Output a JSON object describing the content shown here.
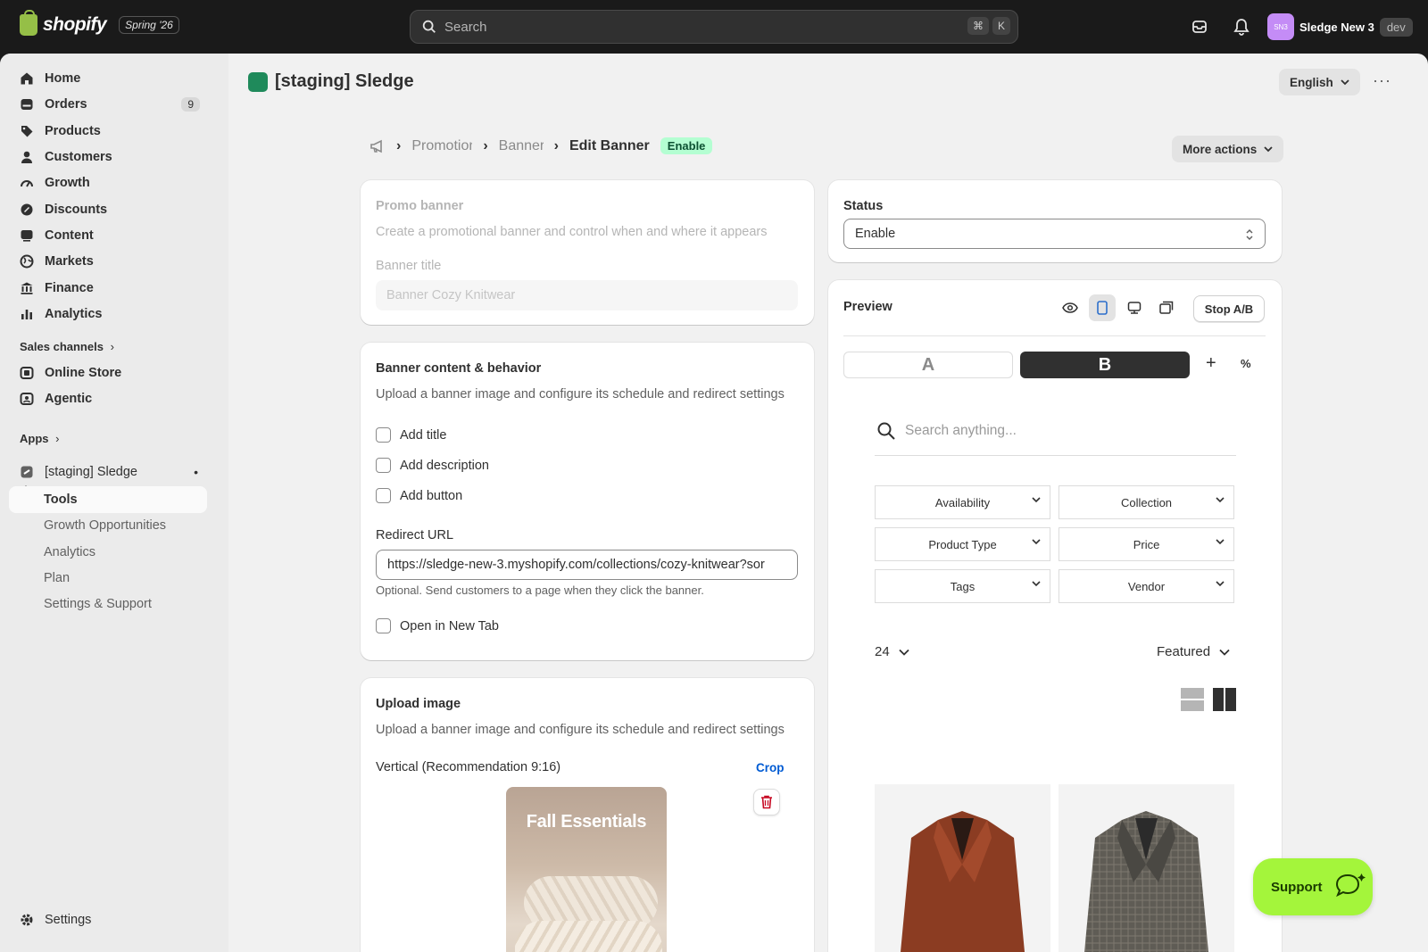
{
  "topbar": {
    "logo_text": "shopify",
    "edition_badge": "Spring '26",
    "search_placeholder": "Search",
    "shortcut_cmd": "⌘",
    "shortcut_key": "K",
    "store_initials": "SN3",
    "store_name": "Sledge New 3",
    "store_env": "dev"
  },
  "sidebar": {
    "items": [
      {
        "label": "Home",
        "icon": "home-icon"
      },
      {
        "label": "Orders",
        "icon": "orders-icon",
        "badge": "9"
      },
      {
        "label": "Products",
        "icon": "tag-icon"
      },
      {
        "label": "Customers",
        "icon": "person-icon"
      },
      {
        "label": "Growth",
        "icon": "growth-icon"
      },
      {
        "label": "Discounts",
        "icon": "discount-icon"
      },
      {
        "label": "Content",
        "icon": "content-icon"
      },
      {
        "label": "Markets",
        "icon": "globe-icon"
      },
      {
        "label": "Finance",
        "icon": "bank-icon"
      },
      {
        "label": "Analytics",
        "icon": "bar-chart-icon"
      }
    ],
    "sales_channels_label": "Sales channels",
    "channels": [
      {
        "label": "Online Store",
        "icon": "store-icon"
      },
      {
        "label": "Agentic",
        "icon": "agentic-icon"
      }
    ],
    "apps_label": "Apps",
    "app_name": "[staging] Sledge",
    "app_sub": [
      "Tools",
      "Growth Opportunities",
      "Analytics",
      "Plan",
      "Settings & Support"
    ],
    "settings_label": "Settings"
  },
  "header": {
    "app_title": "[staging] Sledge",
    "language": "English"
  },
  "breadcrumb": {
    "items": [
      "Promotion",
      "Banner"
    ],
    "current": "Edit Banner",
    "status_badge": "Enable",
    "more_actions": "More actions"
  },
  "promo_card": {
    "title": "Promo banner",
    "description": "Create a promotional banner and control when and where it appears",
    "field_label": "Banner title",
    "field_value": "Banner Cozy Knitwear"
  },
  "content_card": {
    "title": "Banner content & behavior",
    "description": "Upload a banner image and configure its schedule and redirect settings",
    "checkboxes": [
      "Add title",
      "Add description",
      "Add button"
    ],
    "redirect_label": "Redirect URL",
    "redirect_value": "https://sledge-new-3.myshopify.com/collections/cozy-knitwear?sor",
    "redirect_help": "Optional. Send customers to a page when they click the banner.",
    "new_tab_label": "Open in New Tab"
  },
  "upload_card": {
    "title": "Upload image",
    "description": "Upload a banner image and configure its schedule and redirect settings",
    "vertical_label": "Vertical (Recommendation 9:16)",
    "crop_label": "Crop",
    "image_caption": "Fall Essentials"
  },
  "status_card": {
    "title": "Status",
    "value": "Enable"
  },
  "preview_card": {
    "title": "Preview",
    "stop_ab": "Stop A/B",
    "variant_a": "A",
    "variant_b": "B",
    "add_symbol": "+",
    "percent_symbol": "%",
    "search_placeholder": "Search anything...",
    "filters": [
      "Availability",
      "Collection",
      "Product Type",
      "Price",
      "Tags",
      "Vendor"
    ],
    "per_page": "24",
    "sort": "Featured"
  },
  "support": {
    "label": "Support"
  },
  "colors": {
    "brand_green": "#95bf47",
    "enable_badge_bg": "#b4fed2",
    "support_bg": "#a4f53b",
    "accent_blue": "#005bd3"
  }
}
